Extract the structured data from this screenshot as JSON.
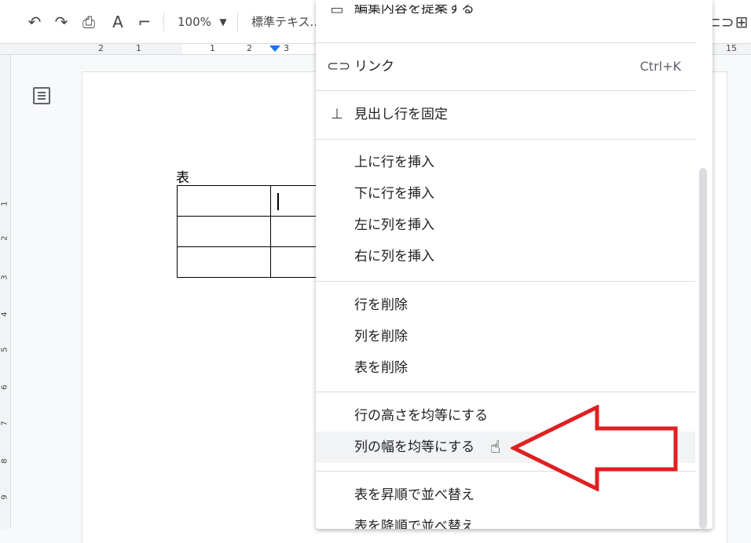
{
  "toolbar": {
    "zoom": "100%",
    "style": "標準テキス...",
    "icons": [
      "undo-icon",
      "redo-icon",
      "print-icon",
      "spellcheck-icon",
      "paint-format-icon",
      "chevron-down-icon",
      "link-icon",
      "add-comment-icon"
    ]
  },
  "ruler": {
    "labels": [
      "2",
      "1",
      "1",
      "2",
      "3",
      "15"
    ],
    "vlabels": [
      "1",
      "2",
      "3",
      "4",
      "5",
      "6",
      "7",
      "8",
      "9"
    ]
  },
  "document": {
    "label": "表"
  },
  "menu": {
    "top_partial": "編集内容を提案する",
    "link": "リンク",
    "link_shortcut": "Ctrl+K",
    "pin_header": "見出し行を固定",
    "insert_row_above": "上に行を挿入",
    "insert_row_below": "下に行を挿入",
    "insert_col_left": "左に列を挿入",
    "insert_col_right": "右に列を挿入",
    "delete_row": "行を削除",
    "delete_col": "列を削除",
    "delete_table": "表を削除",
    "distribute_rows": "行の高さを均等にする",
    "distribute_cols": "列の幅を均等にする",
    "sort_asc": "表を昇順で並べ替え",
    "sort_desc": "表を降順で並べ替え"
  },
  "colors": {
    "arrow": "#e02020",
    "accent": "#1a73e8"
  }
}
